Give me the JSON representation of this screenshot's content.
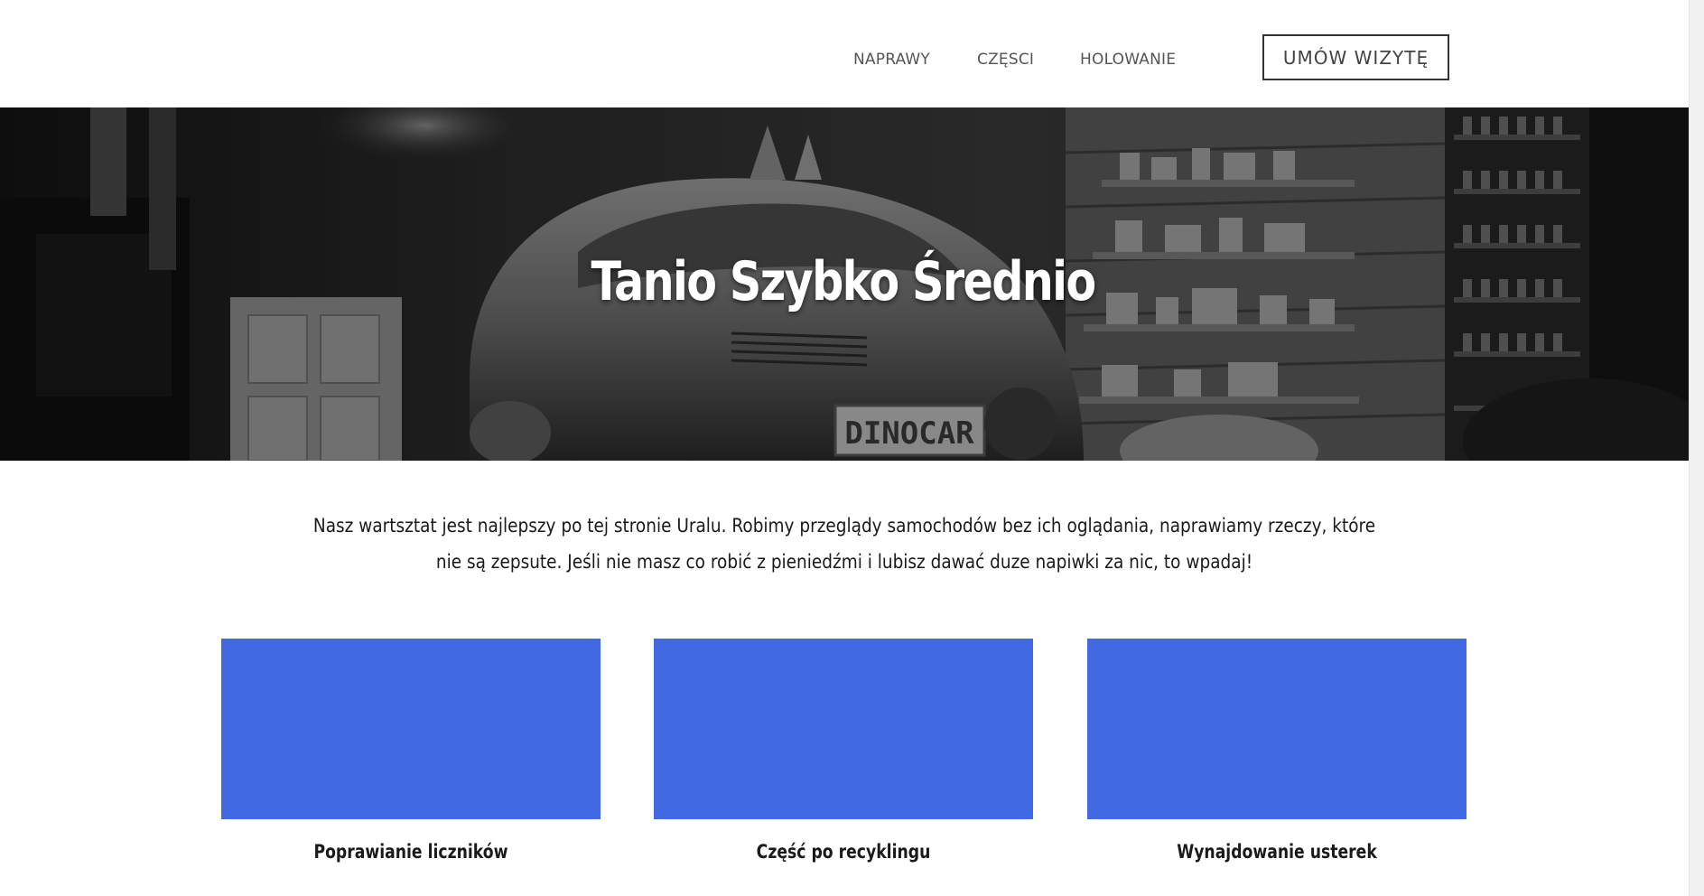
{
  "nav": {
    "items": [
      {
        "label": "NAPRAWY"
      },
      {
        "label": "CZĘSCI"
      },
      {
        "label": "HOLOWANIE"
      }
    ],
    "cta_label": "UMÓW WIZYTĘ"
  },
  "hero": {
    "title": "Tanio Szybko Średnio",
    "plate_text": "DINOCAR"
  },
  "intro": {
    "text": "Nasz wartsztat jest najlepszy po tej stronie Uralu. Robimy przeglądy samochodów bez ich oglądania, naprawiamy rzeczy, które nie są zepsute. Jeśli nie masz co robić z pieniedźmi i lubisz dawać duze napiwki za nic, to wpadaj!"
  },
  "cards": [
    {
      "title": "Poprawianie liczników",
      "color": "#4169e1"
    },
    {
      "title": "Część po recyklingu",
      "color": "#4169e1"
    },
    {
      "title": "Wynajdowanie usterek",
      "color": "#4169e1"
    }
  ]
}
